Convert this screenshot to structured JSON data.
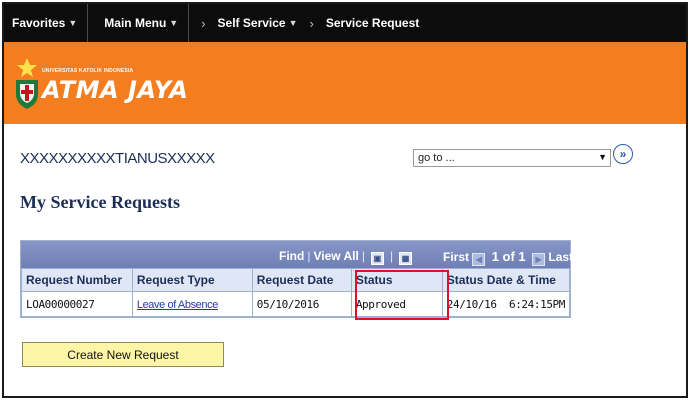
{
  "nav": {
    "favorites": "Favorites",
    "main_menu": "Main Menu",
    "self_service": "Self Service",
    "service_request": "Service Request",
    "dropdown_arrow": "▼",
    "breadcrumb_separator": "›"
  },
  "brand": {
    "small_text": "UNIVERSITAS KATOLIK INDONESIA",
    "name": "ATMA JAYA",
    "header_color": "#f47d20"
  },
  "user": {
    "name": "XXXXXXXXXXTIANUSXXXXX"
  },
  "goto": {
    "value": "go to ...",
    "button_icon": "double-chevron-right-icon"
  },
  "page": {
    "title": "My Service Requests"
  },
  "grid": {
    "find": "Find",
    "view_all": "View All",
    "first": "First",
    "pager": "1 of 1",
    "last": "Last",
    "columns": [
      "Request Number",
      "Request Type",
      "Request Date",
      "Status",
      "Status Date & Time"
    ],
    "rows": [
      {
        "request_number": "LOA00000027",
        "request_type": "Leave of Absence",
        "request_date": "05/10/2016",
        "status": "Approved",
        "status_datetime": "24/10/16  6:24:15PM"
      }
    ],
    "highlight_color": "#e0102a"
  },
  "actions": {
    "create_new": "Create New Request"
  }
}
